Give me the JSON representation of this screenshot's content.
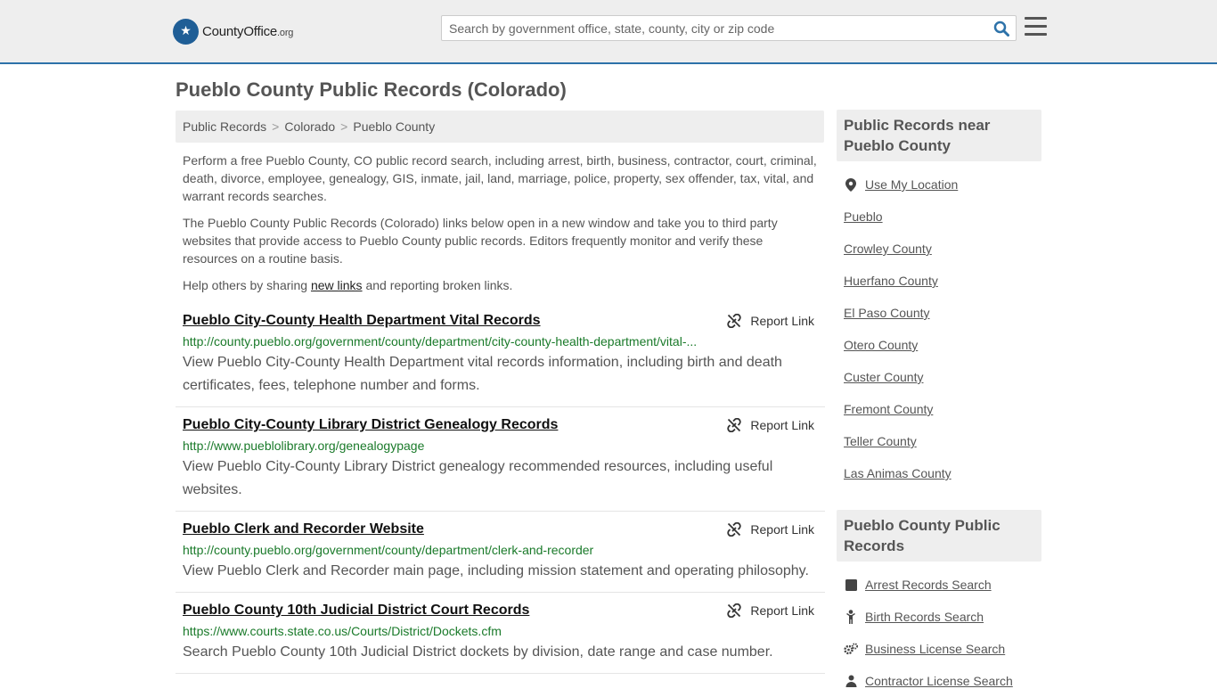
{
  "header": {
    "logo_badge": "★",
    "logo_name": "CountyOffice",
    "logo_tld": ".org",
    "search_placeholder": "Search by government office, state, county, city or zip code"
  },
  "page": {
    "title": "Pueblo County Public Records (Colorado)"
  },
  "breadcrumb": [
    "Public Records",
    "Colorado",
    "Pueblo County"
  ],
  "intro": {
    "p1": "Perform a free Pueblo County, CO public record search, including arrest, birth, business, contractor, court, criminal, death, divorce, employee, genealogy, GIS, inmate, jail, land, marriage, police, property, sex offender, tax, vital, and warrant records searches.",
    "p2": "The Pueblo County Public Records (Colorado) links below open in a new window and take you to third party websites that provide access to Pueblo County public records. Editors frequently monitor and verify these resources on a routine basis.",
    "p3_before": "Help others by sharing ",
    "p3_link": "new links",
    "p3_after": " and reporting broken links."
  },
  "report_label": "Report Link",
  "results": [
    {
      "title": "Pueblo City-County Health Department Vital Records",
      "url": "http://county.pueblo.org/government/county/department/city-county-health-department/vital-...",
      "desc": "View Pueblo City-County Health Department vital records information, including birth and death certificates, fees, telephone number and forms."
    },
    {
      "title": "Pueblo City-County Library District Genealogy Records",
      "url": "http://www.pueblolibrary.org/genealogypage",
      "desc": "View Pueblo City-County Library District genealogy recommended resources, including useful websites."
    },
    {
      "title": "Pueblo Clerk and Recorder Website",
      "url": "http://county.pueblo.org/government/county/department/clerk-and-recorder",
      "desc": "View Pueblo Clerk and Recorder main page, including mission statement and operating philosophy."
    },
    {
      "title": "Pueblo County 10th Judicial District Court Records",
      "url": "https://www.courts.state.co.us/Courts/District/Dockets.cfm",
      "desc": "Search Pueblo County 10th Judicial District dockets by division, date range and case number."
    }
  ],
  "sidebar": {
    "near_heading": "Public Records near Pueblo County",
    "near_items": [
      {
        "label": "Use My Location",
        "icon": "map-marker-icon"
      },
      {
        "label": "Pueblo"
      },
      {
        "label": "Crowley County"
      },
      {
        "label": "Huerfano County"
      },
      {
        "label": "El Paso County"
      },
      {
        "label": "Otero County"
      },
      {
        "label": "Custer County"
      },
      {
        "label": "Fremont County"
      },
      {
        "label": "Teller County"
      },
      {
        "label": "Las Animas County"
      }
    ],
    "records_heading": "Pueblo County Public Records",
    "records_items": [
      {
        "label": "Arrest Records Search",
        "icon": "square-icon"
      },
      {
        "label": "Birth Records Search",
        "icon": "child-icon"
      },
      {
        "label": "Business License Search",
        "icon": "gears-icon"
      },
      {
        "label": "Contractor License Search",
        "icon": "person-icon"
      }
    ]
  }
}
